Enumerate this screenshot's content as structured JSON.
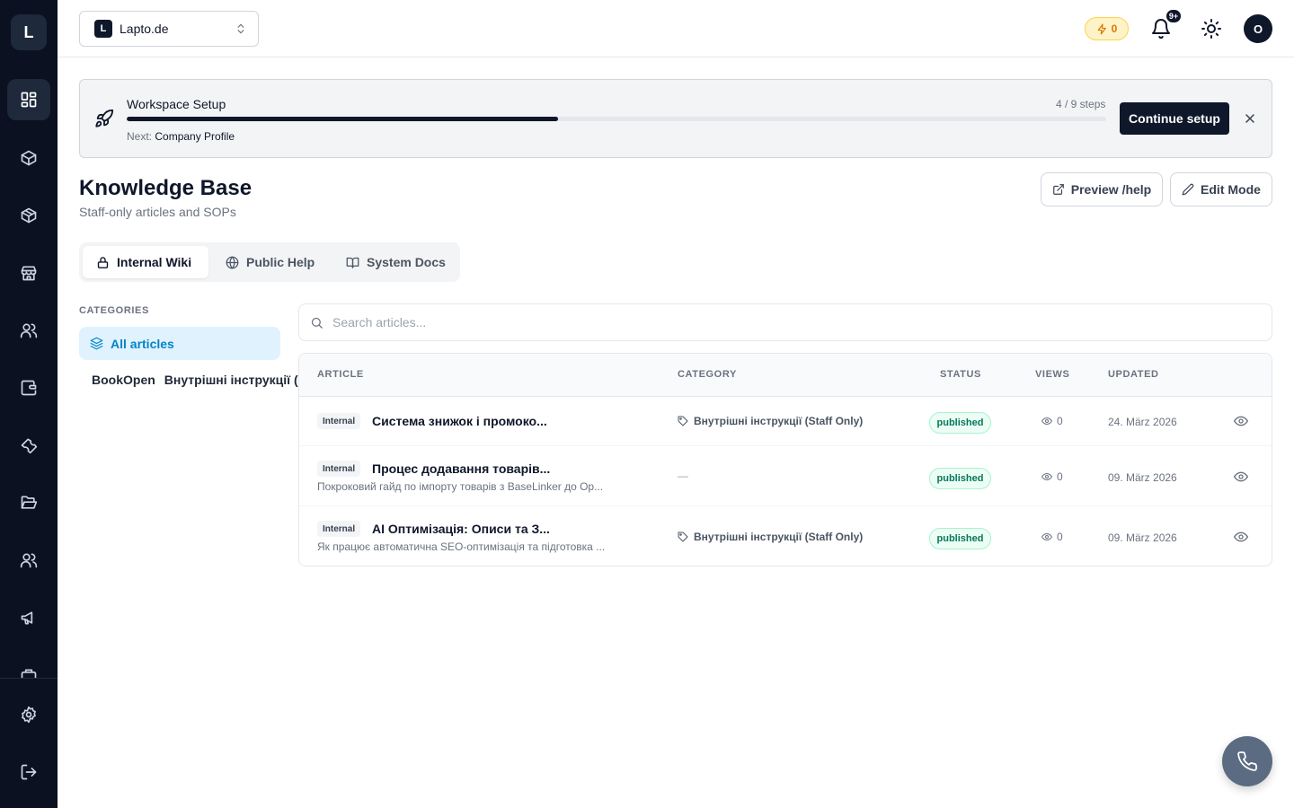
{
  "sidebar": {
    "logo": "L",
    "items": [
      {
        "icon": "dashboard-icon"
      },
      {
        "icon": "package-icon"
      },
      {
        "icon": "package-icon"
      },
      {
        "icon": "store-icon"
      },
      {
        "icon": "users-icon"
      },
      {
        "icon": "wallet-icon"
      },
      {
        "icon": "wrench-icon"
      },
      {
        "icon": "folder-open-icon"
      },
      {
        "icon": "users-icon"
      },
      {
        "icon": "megaphone-icon"
      }
    ],
    "bottom": [
      {
        "icon": "settings-icon"
      },
      {
        "icon": "logout-icon"
      }
    ]
  },
  "topbar": {
    "workspace_badge": "L",
    "workspace_name": "Lapto.de",
    "credits": "0",
    "notifications_badge": "9+",
    "avatar_initial": "O"
  },
  "banner": {
    "title": "Workspace Setup",
    "steps_label": "4 / 9 steps",
    "progress": 0.44,
    "next_prefix": "Next:",
    "next_value": "Company Profile",
    "cta_label": "Continue setup"
  },
  "page": {
    "title": "Knowledge Base",
    "subtitle": "Staff-only articles and SOPs",
    "preview_label": "Preview /help",
    "edit_label": "Edit Mode"
  },
  "tabs": [
    {
      "label": "Internal Wiki",
      "icon": "lock-icon",
      "active": true
    },
    {
      "label": "Public Help",
      "icon": "globe-icon",
      "active": false
    },
    {
      "label": "System Docs",
      "icon": "book-icon",
      "active": false
    }
  ],
  "categories": {
    "heading": "CATEGORIES",
    "all_label": "All articles",
    "items": [
      {
        "icon_text": "BookOpen",
        "label": "Внутрішні інструкції (Staff Only)"
      }
    ]
  },
  "search": {
    "placeholder": "Search articles..."
  },
  "table": {
    "columns": [
      "ARTICLE",
      "CATEGORY",
      "STATUS",
      "VIEWS",
      "UPDATED"
    ],
    "rows": [
      {
        "tag": "Internal",
        "title": "Система знижок і промоко...",
        "description": "",
        "category": "Внутрішні інструкції (Staff Only)",
        "status": "published",
        "views": "0",
        "updated": "24. März 2026"
      },
      {
        "tag": "Internal",
        "title": "Процес додавання товарів...",
        "description": "Покроковий гайд по імпорту товарів з BaseLinker до Op...",
        "category": "—",
        "status": "published",
        "views": "0",
        "updated": "09. März 2026"
      },
      {
        "tag": "Internal",
        "title": "AI Оптимізація: Описи та З...",
        "description": "Як працює автоматична SEO-оптимізація та підготовка ...",
        "category": "Внутрішні інструкції (Staff Only)",
        "status": "published",
        "views": "0",
        "updated": "09. März 2026"
      }
    ]
  },
  "colors": {
    "sidebar_bg": "#0b1120",
    "primary": "#0f172a",
    "accent": "#0284c7",
    "status_green": "#047857",
    "credits_amber": "#d97706"
  }
}
